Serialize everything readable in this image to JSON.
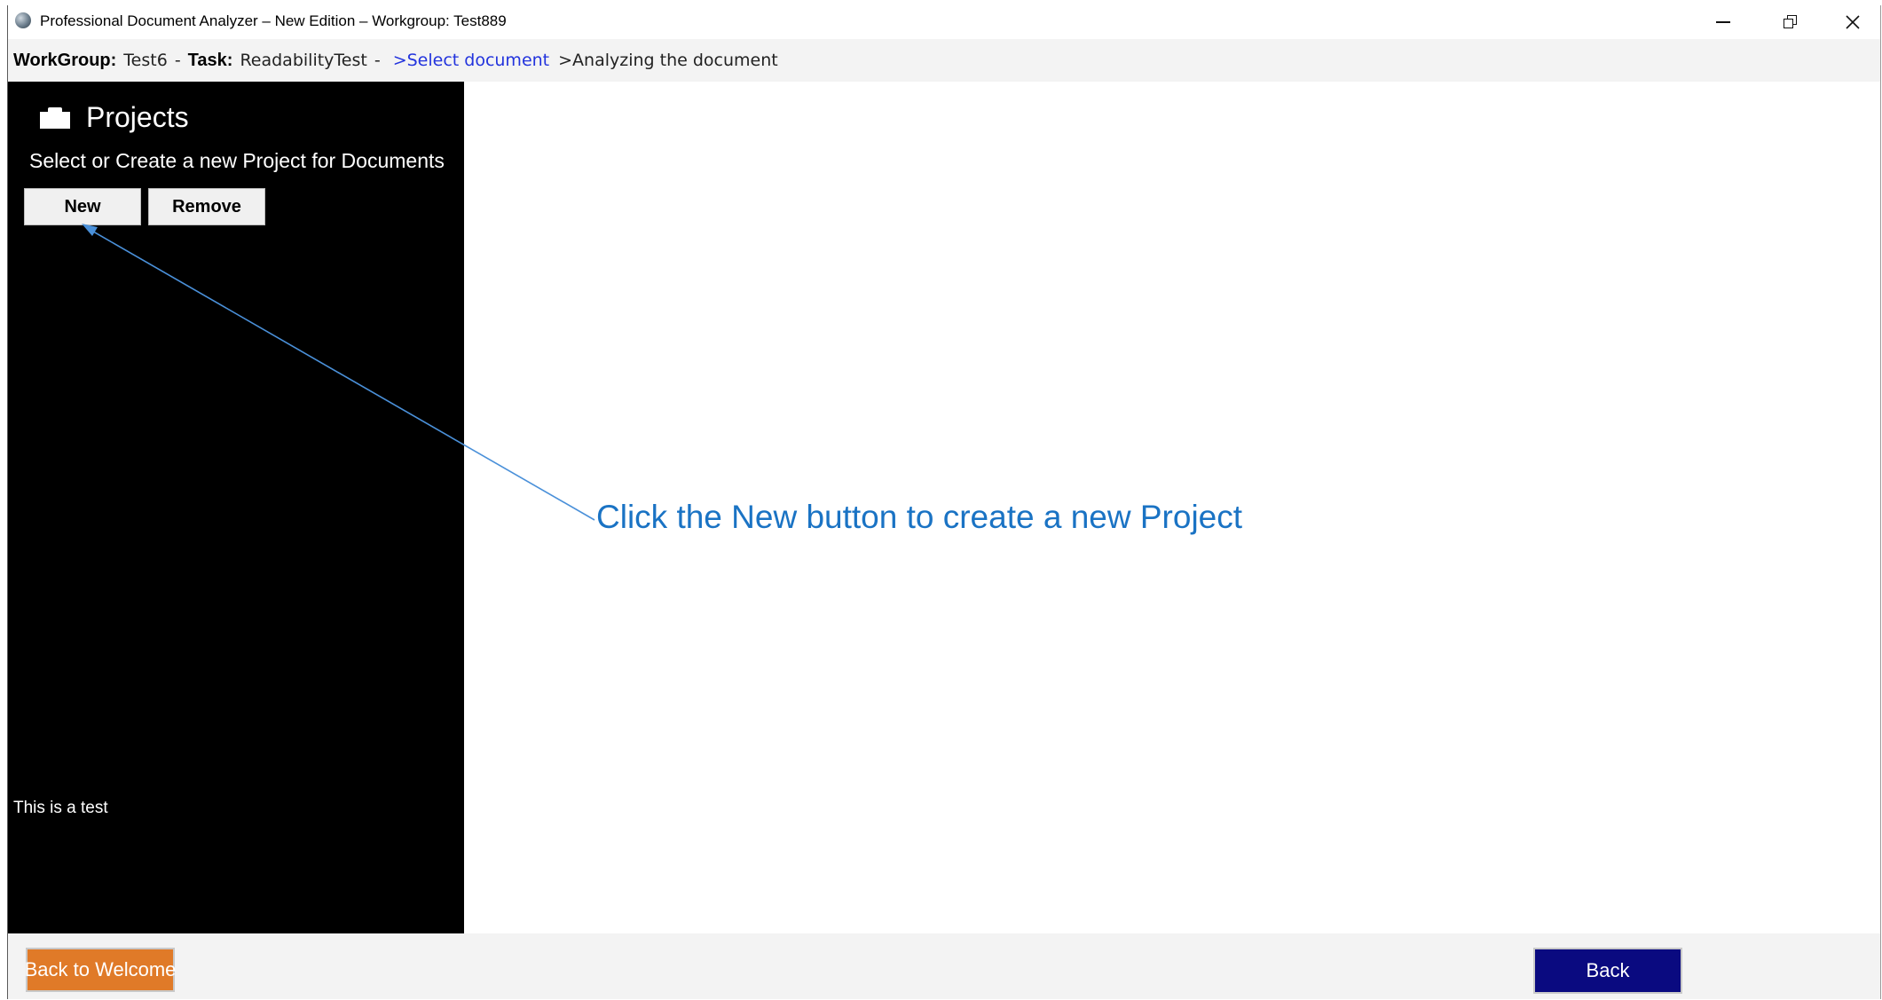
{
  "window": {
    "title": "Professional Document Analyzer – New Edition – Workgroup: Test889",
    "controls": [
      "minimize-icon",
      "restore-icon",
      "close-icon"
    ]
  },
  "breadcrumb": {
    "workgroup_label": "WorkGroup:",
    "workgroup_value": "Test6",
    "separator": "-",
    "task_label": "Task:",
    "task_value": "ReadabilityTest",
    "task_separator": "-",
    "step_select": ">Select document",
    "step_analyze": ">Analyzing the document"
  },
  "sidebar": {
    "icon": "folder-icon",
    "title": "Projects",
    "subtitle": "Select or Create a new Project for Documents",
    "new_button": "New",
    "remove_button": "Remove",
    "note": "This is a test"
  },
  "annotation": {
    "text": "Click the New button to create a new Project",
    "color": "#1a73c4"
  },
  "footer": {
    "back_to_welcome": "Back to Welcome",
    "back": "Back"
  },
  "colors": {
    "sidebar_bg": "#000000",
    "welcome_button": "#e07a28",
    "back_button": "#0a0a80",
    "link": "#2233dd"
  }
}
